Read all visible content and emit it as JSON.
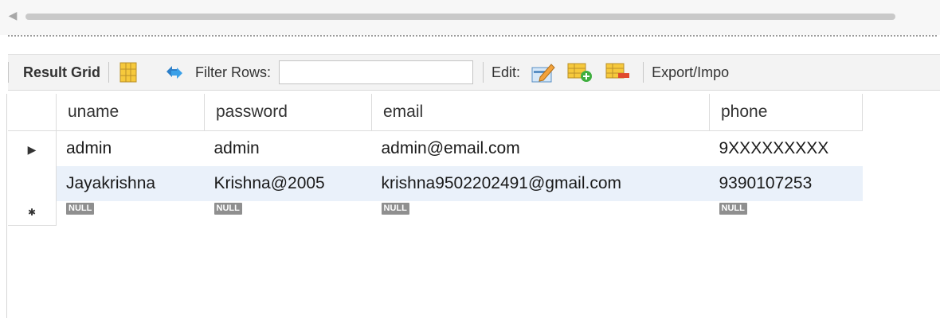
{
  "toolbar": {
    "result_grid_label": "Result Grid",
    "filter_rows_label": "Filter Rows:",
    "filter_value": "",
    "edit_label": "Edit:",
    "export_import_label": "Export/Impo",
    "icons": [
      "grid-layout-icon",
      "refresh-icon",
      "edit-pencil-icon",
      "add-row-icon",
      "delete-row-icon"
    ]
  },
  "grid": {
    "columns": [
      "uname",
      "password",
      "email",
      "phone"
    ],
    "rows": [
      [
        "admin",
        "admin",
        "admin@email.com",
        "9XXXXXXXXX"
      ],
      [
        "Jayakrishna",
        "Krishna@2005",
        "krishna9502202491@gmail.com",
        "9390107253"
      ]
    ],
    "null_label": "NULL",
    "current_row_marker": "▶",
    "new_row_marker": "✱"
  },
  "colors": {
    "selected_row": "#eaf1fa",
    "null_badge": "#8f8f8f"
  }
}
